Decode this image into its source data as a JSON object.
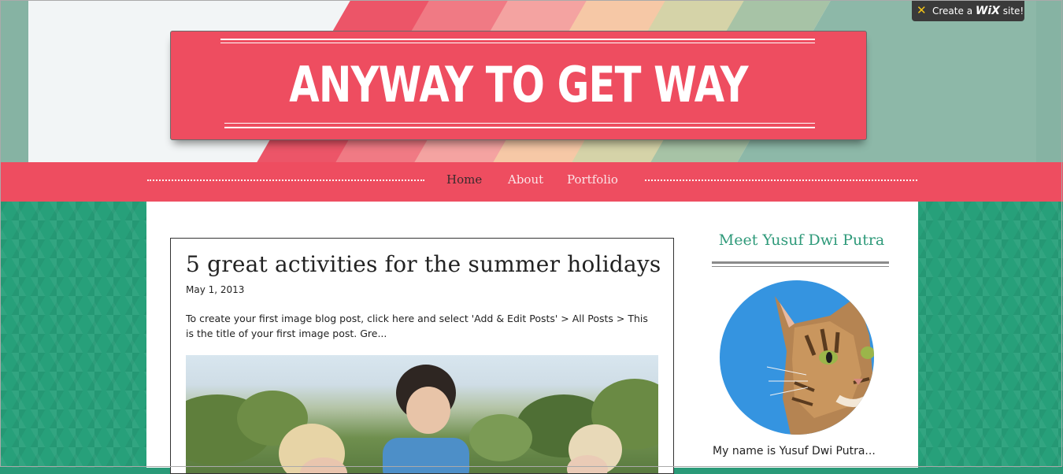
{
  "wix_badge": {
    "prefix": "Create a",
    "brand": "WiX",
    "suffix": "site!",
    "icon": "wix-x-icon"
  },
  "header": {
    "title": "ANYWAY TO GET WAY",
    "colors": {
      "banner": "#ee4d60",
      "stripes": [
        "#e8475c",
        "#f2737f",
        "#f6a3a0",
        "#f8c7a4",
        "#d9d2a6",
        "#9cbfa4",
        "#86b3a3"
      ]
    }
  },
  "nav": {
    "items": [
      {
        "label": "Home",
        "active": true
      },
      {
        "label": "About",
        "active": false
      },
      {
        "label": "Portfolio",
        "active": false
      }
    ]
  },
  "post": {
    "title": "5 great activities for the summer holidays",
    "date": "May 1, 2013",
    "excerpt": "To create your first image blog post, click here and select 'Add & Edit Posts' > All Posts > This is the title of your first image post. Gre..."
  },
  "sidebar": {
    "title": "Meet Yusuf Dwi Putra",
    "bio": "My name is Yusuf Dwi Putra...",
    "accent": "#2f9a7a"
  }
}
